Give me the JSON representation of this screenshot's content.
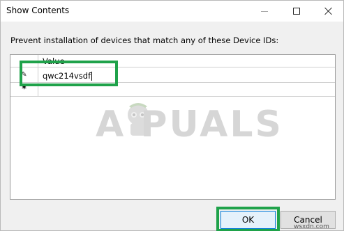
{
  "window": {
    "title": "Show Contents",
    "controls": {
      "minimize": "minimize",
      "maximize": "maximize",
      "close": "close"
    }
  },
  "prompt": "Prevent installation of devices that match any of these Device IDs:",
  "grid": {
    "column_header": "Value",
    "rows": [
      {
        "indicator": "pencil-icon",
        "value": "qwc214vsdf"
      },
      {
        "indicator": "new-row-star-icon",
        "value": ""
      }
    ]
  },
  "watermark": {
    "text": "A  PUALS",
    "site": "wsxdn.com"
  },
  "buttons": {
    "ok_label": "OK",
    "cancel_label": "Cancel"
  },
  "colors": {
    "highlight": "#1fa24a",
    "ok_border": "#0078d7"
  }
}
